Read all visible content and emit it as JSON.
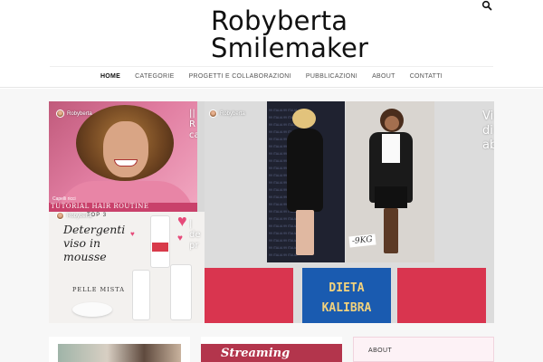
{
  "header": {
    "title_line1": "Robyberta",
    "title_line2": "Smilemaker"
  },
  "nav": {
    "items": [
      {
        "label": "HOME"
      },
      {
        "label": "CATEGORIE"
      },
      {
        "label": "PROGETTI E COLLABORAZIONI"
      },
      {
        "label": "PUBBLICAZIONI"
      },
      {
        "label": "ABOUT"
      },
      {
        "label": "CONTATTI"
      }
    ]
  },
  "featured": {
    "tile1": {
      "author": "Robyberta",
      "category": "Capelli ricci",
      "banner": "TUTORIAL HAIR ROUTINE",
      "title_fragment": "||\nR\nca"
    },
    "tile2": {
      "author": "Robyberta",
      "top": "TOP 3",
      "heading_line1": "Detergenti",
      "heading_line2": "viso in",
      "heading_line3": "mousse",
      "subheading": "PELLE MISTA",
      "title_fragment": "|\nde\npr"
    },
    "tile3": {
      "author": "Robyberta",
      "kg_label": "-9KG",
      "dieta_line1": "DIETA",
      "dieta_line2": "KALIBRA",
      "title_fragment": "Vi\ndi\nab"
    }
  },
  "cards": {
    "card2_text": "Streaming"
  },
  "sidebar": {
    "widget_title": "ABOUT"
  },
  "colors": {
    "accent_pink": "#c9416b",
    "brand_red": "#d9354f",
    "brand_blue": "#1a5bb0"
  }
}
